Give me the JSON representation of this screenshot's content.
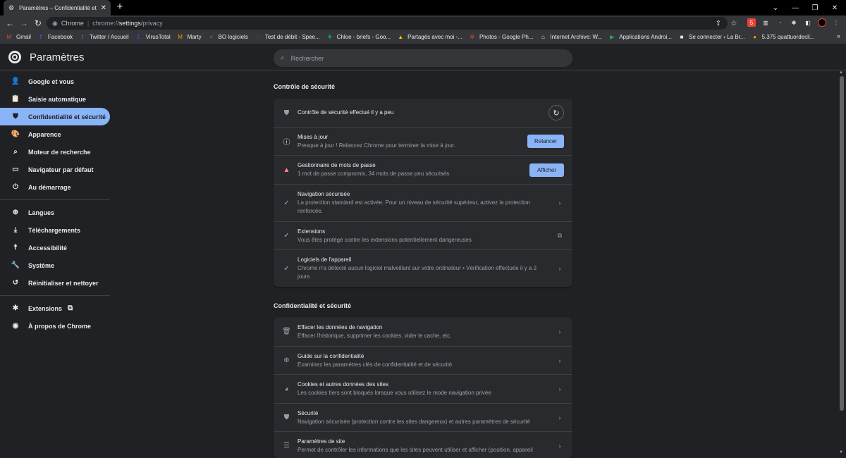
{
  "browser": {
    "tab_title": "Paramètres – Confidentialité et sécurité",
    "tab_close": "✕",
    "new_tab": "+",
    "omnibox_chrome": "Chrome",
    "omnibox_url_prefix": "chrome://",
    "omnibox_url_host": "settings",
    "omnibox_url_path": "/privacy",
    "bookmarks": [
      {
        "label": "Gmail",
        "icon": "gmail-icon",
        "color": "#ea4335",
        "glyph": "M"
      },
      {
        "label": "Facebook",
        "icon": "facebook-icon",
        "color": "#1877f2",
        "glyph": "f"
      },
      {
        "label": "Twitter / Accueil",
        "icon": "twitter-icon",
        "color": "#1d9bf0",
        "glyph": "t"
      },
      {
        "label": "VirusTotal",
        "icon": "virustotal-icon",
        "color": "#394eff",
        "glyph": "Σ"
      },
      {
        "label": "Marty",
        "icon": "marty-icon",
        "color": "#f29900",
        "glyph": "M"
      },
      {
        "label": "BO logiciels",
        "icon": "bo-icon",
        "color": "#9aa0a6",
        "glyph": "♂"
      },
      {
        "label": "Test de débit - Spee...",
        "icon": "speedtest-icon",
        "color": "#34a853",
        "glyph": "◌"
      },
      {
        "label": "Chloe - briefs - Goo...",
        "icon": "sheets-icon",
        "color": "#0f9d58",
        "glyph": "✚"
      },
      {
        "label": "Partagés avec moi -...",
        "icon": "drive-icon",
        "color": "#fbbc04",
        "glyph": "▲"
      },
      {
        "label": "Photos - Google Ph...",
        "icon": "photos-icon",
        "color": "#ea4335",
        "glyph": "✲"
      },
      {
        "label": "Internet Archive: W...",
        "icon": "archive-icon",
        "color": "#e8eaed",
        "glyph": "⌂"
      },
      {
        "label": "Applications Androi...",
        "icon": "play-icon",
        "color": "#34a853",
        "glyph": "▶"
      },
      {
        "label": "Se connecter ‹ La Br...",
        "icon": "wordpress-icon",
        "color": "#e8eaed",
        "glyph": "■"
      },
      {
        "label": "5.375 quattuordecil...",
        "icon": "cookie-icon",
        "color": "#f29900",
        "glyph": "●"
      }
    ]
  },
  "header": {
    "title": "Paramètres",
    "search_placeholder": "Rechercher"
  },
  "sidebar": {
    "items": [
      {
        "label": "Google et vous",
        "icon": "person-icon",
        "glyph": "👤"
      },
      {
        "label": "Saisie automatique",
        "icon": "clipboard-icon",
        "glyph": "📋"
      },
      {
        "label": "Confidentialité et sécurité",
        "icon": "shield-icon",
        "glyph": "⛊"
      },
      {
        "label": "Apparence",
        "icon": "palette-icon",
        "glyph": "🎨"
      },
      {
        "label": "Moteur de recherche",
        "icon": "search-icon",
        "glyph": "⌕"
      },
      {
        "label": "Navigateur par défaut",
        "icon": "browser-icon",
        "glyph": "▭"
      },
      {
        "label": "Au démarrage",
        "icon": "power-icon",
        "glyph": "⏻"
      },
      {
        "label": "Langues",
        "icon": "globe-icon",
        "glyph": "⊕"
      },
      {
        "label": "Téléchargements",
        "icon": "download-icon",
        "glyph": "⤓"
      },
      {
        "label": "Accessibilité",
        "icon": "accessibility-icon",
        "glyph": "☨"
      },
      {
        "label": "Système",
        "icon": "wrench-icon",
        "glyph": "🔧"
      },
      {
        "label": "Réinitialiser et nettoyer",
        "icon": "restore-icon",
        "glyph": "↺"
      },
      {
        "label": "Extensions",
        "icon": "puzzle-icon",
        "glyph": "✱"
      },
      {
        "label": "À propos de Chrome",
        "icon": "chrome-icon",
        "glyph": "◉"
      }
    ],
    "active_index": 2
  },
  "safety_check": {
    "section_title": "Contrôle de sécurité",
    "header_row": "Contrôle de sécurité effectué il y a peu",
    "rows": [
      {
        "title": "Mises à jour",
        "desc": "Presque à jour ! Relancez Chrome pour terminer la mise à jour.",
        "button": "Relancer"
      },
      {
        "title": "Gestionnaire de mots de passe",
        "desc": "1 mot de passe compromis, 34 mots de passe peu sécurisés",
        "button": "Afficher"
      },
      {
        "title": "Navigation sécurisée",
        "desc": "La protection standard est activée. Pour un niveau de sécurité supérieur, activez la protection renforcée."
      },
      {
        "title": "Extensions",
        "desc": "Vous êtes protégé contre les extensions potentiellement dangereuses"
      },
      {
        "title": "Logiciels de l'appareil",
        "desc": "Chrome n'a détecté aucun logiciel malveillant sur votre ordinateur • Vérification effectuée il y a 2 jours"
      }
    ]
  },
  "privacy": {
    "section_title": "Confidentialité et sécurité",
    "rows": [
      {
        "title": "Effacer les données de navigation",
        "desc": "Effacer l'historique, supprimer les cookies, vider le cache, etc."
      },
      {
        "title": "Guide sur la confidentialité",
        "desc": "Examinez les paramètres clés de confidentialité et de sécurité"
      },
      {
        "title": "Cookies et autres données des sites",
        "desc": "Les cookies tiers sont bloqués lorsque vous utilisez le mode navigation privée"
      },
      {
        "title": "Sécurité",
        "desc": "Navigation sécurisée (protection contre les sites dangereux) et autres paramètres de sécurité"
      },
      {
        "title": "Paramètres de site",
        "desc": "Permet de contrôler les informations que les sites peuvent utiliser et afficher (position, appareil"
      }
    ]
  },
  "colors": {
    "accent": "#8ab4f8",
    "background": "#202124",
    "card": "#292a2d",
    "warning": "#f28b82"
  }
}
